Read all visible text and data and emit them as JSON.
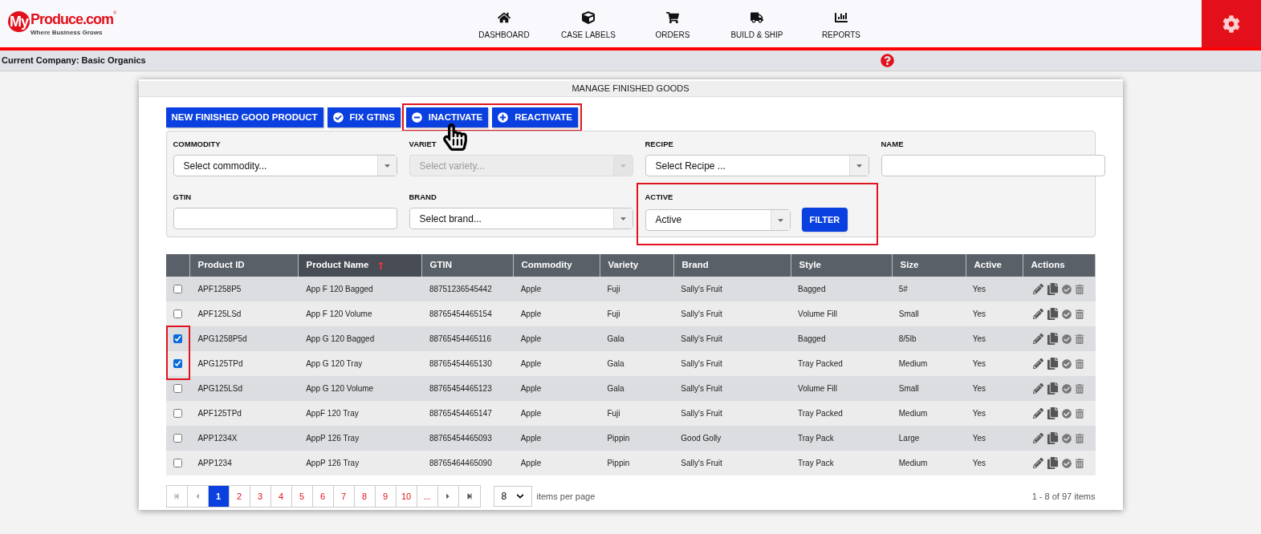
{
  "logo": {
    "brand_my": "My",
    "brand_rest": "Produce.com",
    "reg": "®",
    "tagline": "Where Business Grows"
  },
  "nav": [
    {
      "label": "DASHBOARD",
      "kind": "home"
    },
    {
      "label": "CASE LABELS",
      "kind": "cube"
    },
    {
      "label": "ORDERS",
      "kind": "cart"
    },
    {
      "label": "BUILD & SHIP",
      "kind": "truck"
    },
    {
      "label": "REPORTS",
      "kind": "chart"
    }
  ],
  "company_bar": {
    "text": "Current Company: Basic Organics"
  },
  "panel": {
    "title": "MANAGE FINISHED GOODS"
  },
  "buttons": [
    {
      "label": "NEW FINISHED GOOD PRODUCT",
      "kind": "plain",
      "highlighted": false
    },
    {
      "label": "FIX GTINS",
      "kind": "check",
      "highlighted": false
    },
    {
      "label": "INACTIVATE",
      "kind": "minus",
      "highlighted": true
    },
    {
      "label": "REACTIVATE",
      "kind": "plus",
      "highlighted": true
    }
  ],
  "filters": [
    {
      "label": "COMMODITY",
      "kind": "select",
      "placeholder": "Select commodity...",
      "disabled": false,
      "highlighted": false
    },
    {
      "label": "VARIET",
      "kind": "select",
      "placeholder": "Select variety...",
      "disabled": true,
      "highlighted": false
    },
    {
      "label": "RECIPE",
      "kind": "select",
      "placeholder": "Select Recipe ...",
      "disabled": false,
      "highlighted": false
    },
    {
      "label": "NAME",
      "kind": "text",
      "disabled": false,
      "highlighted": false
    },
    {
      "label": "GTIN",
      "kind": "text",
      "disabled": false,
      "highlighted": false
    },
    {
      "label": "BRAND",
      "kind": "select",
      "placeholder": "Select brand...",
      "disabled": false,
      "highlighted": false
    },
    {
      "label": "ACTIVE",
      "kind": "select",
      "value": "Active",
      "disabled": false,
      "highlighted": true,
      "button": "FILTER"
    }
  ],
  "table": {
    "columns": [
      {
        "label": "Product ID",
        "sorted": false
      },
      {
        "label": "Product Name",
        "sorted": true
      },
      {
        "label": "GTIN",
        "sorted": false
      },
      {
        "label": "Commodity",
        "sorted": false
      },
      {
        "label": "Variety",
        "sorted": false
      },
      {
        "label": "Brand",
        "sorted": false
      },
      {
        "label": "Style",
        "sorted": false
      },
      {
        "label": "Size",
        "sorted": false
      },
      {
        "label": "Active",
        "sorted": false
      },
      {
        "label": "Actions",
        "sorted": false
      }
    ],
    "rows": [
      {
        "checked": false,
        "cells": [
          "APF1258P5",
          "App F 120 Bagged",
          "88751236545442",
          "Apple",
          "Fuji",
          "Sally's Fruit",
          "Bagged",
          "5#",
          "Yes"
        ]
      },
      {
        "checked": false,
        "cells": [
          "APF125LSd",
          "App F 120 Volume",
          "88765454465154",
          "Apple",
          "Fuji",
          "Sally's Fruit",
          "Volume Fill",
          "Small",
          "Yes"
        ]
      },
      {
        "checked": true,
        "cells": [
          "APG1258P5d",
          "App G 120 Bagged",
          "88765454465116",
          "Apple",
          "Gala",
          "Sally's Fruit",
          "Bagged",
          "8/5lb",
          "Yes"
        ]
      },
      {
        "checked": true,
        "cells": [
          "APG125TPd",
          "App G 120 Tray",
          "88765454465130",
          "Apple",
          "Gala",
          "Sally's Fruit",
          "Tray Packed",
          "Medium",
          "Yes"
        ]
      },
      {
        "checked": false,
        "cells": [
          "APG125LSd",
          "App G 120 Volume",
          "88765454465123",
          "Apple",
          "Gala",
          "Sally's Fruit",
          "Volume Fill",
          "Small",
          "Yes"
        ]
      },
      {
        "checked": false,
        "cells": [
          "APF125TPd",
          "AppF 120 Tray",
          "88765454465147",
          "Apple",
          "Fuji",
          "Sally's Fruit",
          "Tray Packed",
          "Medium",
          "Yes"
        ]
      },
      {
        "checked": false,
        "cells": [
          "APP1234X",
          "AppP 126 Tray",
          "88765454465093",
          "Apple",
          "Pippin",
          "Good Golly",
          "Tray Pack",
          "Large",
          "Yes"
        ]
      },
      {
        "checked": false,
        "cells": [
          "APP1234",
          "AppP 126 Tray",
          "88765464465090",
          "Apple",
          "Pippin",
          "Sally's Fruit",
          "Tray Pack",
          "Medium",
          "Yes"
        ]
      }
    ]
  },
  "pager": {
    "pages": [
      {
        "label": "1",
        "selected": true
      },
      {
        "label": "2",
        "selected": false
      },
      {
        "label": "3",
        "selected": false
      },
      {
        "label": "4",
        "selected": false
      },
      {
        "label": "5",
        "selected": false
      },
      {
        "label": "6",
        "selected": false
      },
      {
        "label": "7",
        "selected": false
      },
      {
        "label": "8",
        "selected": false
      },
      {
        "label": "9",
        "selected": false
      },
      {
        "label": "10",
        "selected": false
      },
      {
        "label": "...",
        "selected": false
      }
    ],
    "per_page": "8",
    "per_page_label": "items per page",
    "summary": "1 - 8 of 97 items"
  }
}
